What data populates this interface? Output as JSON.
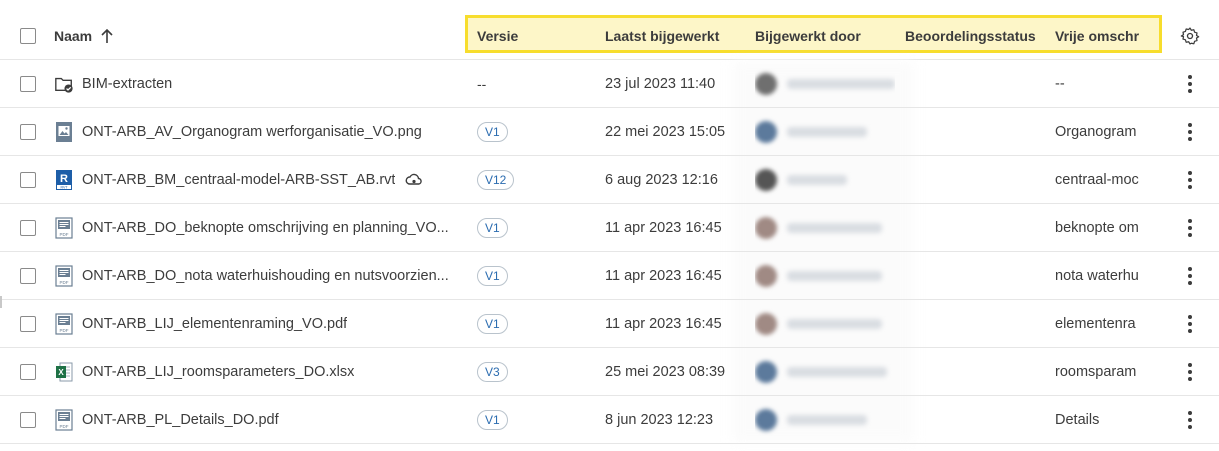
{
  "header": {
    "name": "Naam",
    "versie": "Versie",
    "laatst_bijgewerkt": "Laatst bijgewerkt",
    "bijgewerkt_door": "Bijgewerkt door",
    "beoordelingsstatus": "Beoordelingsstatus",
    "vrije_omschrijving": "Vrije omschr"
  },
  "colors": {
    "highlight_border": "#f7dd2d",
    "highlight_fill": "#fdf6c8",
    "version_badge_text": "#2b6cb0"
  },
  "rows": [
    {
      "name": "BIM-extracten",
      "icon": "folder-shared-icon",
      "version": "--",
      "date": "23 jul 2023 11:40",
      "desc": "--"
    },
    {
      "name": "ONT-ARB_AV_Organogram werforganisatie_VO.png",
      "icon": "image-file-icon",
      "version": "V1",
      "date": "22 mei 2023 15:05",
      "desc": "Organogram"
    },
    {
      "name": "ONT-ARB_BM_centraal-model-ARB-SST_AB.rvt",
      "icon": "revit-file-icon",
      "version": "V12",
      "date": "6 aug 2023 12:16",
      "desc": "centraal-moc"
    },
    {
      "name": "ONT-ARB_DO_beknopte omschrijving en planning_VO...",
      "icon": "pdf-file-icon",
      "version": "V1",
      "date": "11 apr 2023 16:45",
      "desc": "beknopte om"
    },
    {
      "name": "ONT-ARB_DO_nota waterhuishouding en nutsvoorzien...",
      "icon": "pdf-file-icon",
      "version": "V1",
      "date": "11 apr 2023 16:45",
      "desc": "nota waterhu"
    },
    {
      "name": "ONT-ARB_LIJ_elementenraming_VO.pdf",
      "icon": "pdf-file-icon",
      "version": "V1",
      "date": "11 apr 2023 16:45",
      "desc": "elementenra"
    },
    {
      "name": "ONT-ARB_LIJ_roomsparameters_DO.xlsx",
      "icon": "excel-file-icon",
      "version": "V3",
      "date": "25 mei 2023 08:39",
      "desc": "roomsparam"
    },
    {
      "name": "ONT-ARB_PL_Details_DO.pdf",
      "icon": "pdf-file-icon",
      "version": "V1",
      "date": "8 jun 2023 12:23",
      "desc": "Details"
    }
  ]
}
